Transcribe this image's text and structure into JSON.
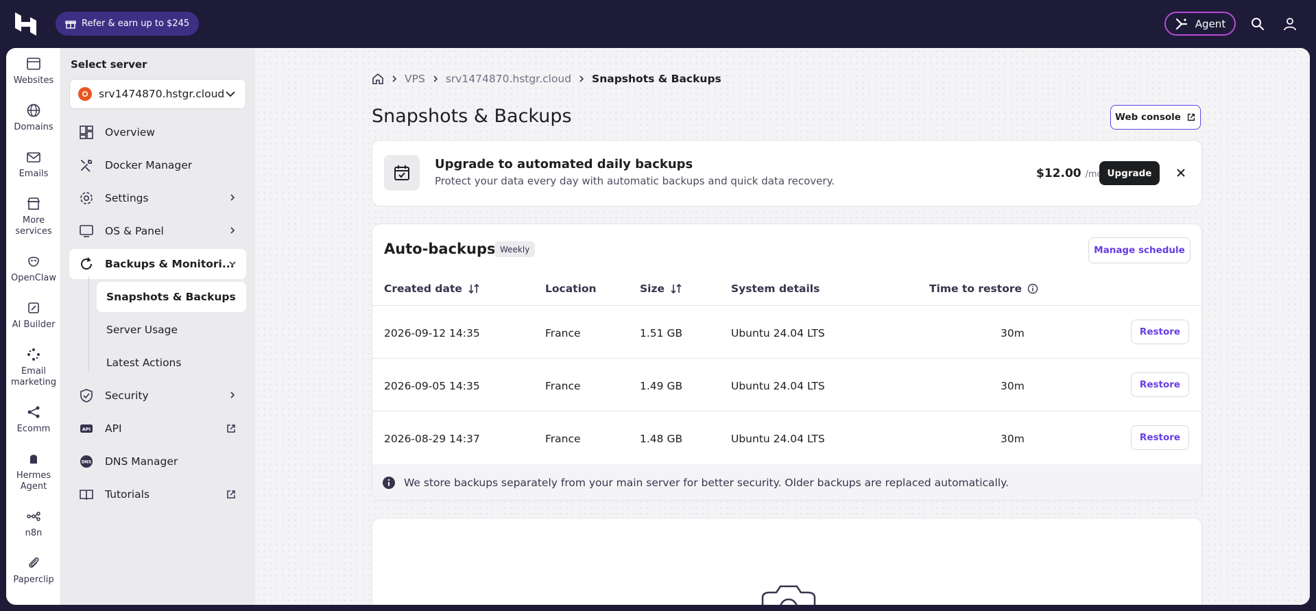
{
  "topbar": {
    "refer_label": "Refer & earn up to $245",
    "agent_label": "Agent"
  },
  "rail": {
    "items": [
      {
        "label": "Websites",
        "icon": "browser-icon"
      },
      {
        "label": "Domains",
        "icon": "globe-icon"
      },
      {
        "label": "Emails",
        "icon": "mail-icon"
      },
      {
        "label": "More services",
        "icon": "store-icon"
      },
      {
        "label": "OpenClaw",
        "icon": "claw-icon"
      },
      {
        "label": "AI Builder",
        "icon": "ai-builder-icon"
      },
      {
        "label": "Email marketing",
        "icon": "sparkle-icon"
      },
      {
        "label": "Ecomm",
        "icon": "share-nodes-icon"
      },
      {
        "label": "Hermes Agent",
        "icon": "hermes-icon"
      },
      {
        "label": "n8n",
        "icon": "n8n-icon"
      },
      {
        "label": "Paperclip",
        "icon": "paperclip-icon"
      }
    ]
  },
  "subnav": {
    "title": "Select server",
    "server": "srv1474870.hstgr.cloud",
    "items": [
      {
        "label": "Overview"
      },
      {
        "label": "Docker Manager"
      },
      {
        "label": "Settings"
      },
      {
        "label": "OS & Panel"
      },
      {
        "label": "Backups & Monitori..."
      },
      {
        "label": "Security"
      },
      {
        "label": "API"
      },
      {
        "label": "DNS Manager"
      },
      {
        "label": "Tutorials"
      }
    ],
    "sub_items": [
      {
        "label": "Snapshots & Backups"
      },
      {
        "label": "Server Usage"
      },
      {
        "label": "Latest Actions"
      }
    ]
  },
  "breadcrumb": {
    "items": [
      "VPS",
      "srv1474870.hstgr.cloud",
      "Snapshots & Backups"
    ]
  },
  "page": {
    "title": "Snapshots & Backups",
    "web_console_label": "Web console"
  },
  "upgrade": {
    "title": "Upgrade to automated daily backups",
    "description": "Protect your data every day with automatic backups and quick data recovery.",
    "price": "$12.00",
    "period": "/mo",
    "button_label": "Upgrade"
  },
  "autobackups": {
    "title": "Auto-backups",
    "frequency_badge": "Weekly",
    "manage_label": "Manage schedule",
    "columns": [
      "Created date",
      "Location",
      "Size",
      "System details",
      "Time to restore"
    ],
    "rows": [
      {
        "date": "2026-09-12 14:35",
        "location": "France",
        "size": "1.51 GB",
        "system": "Ubuntu 24.04 LTS",
        "time": "30m",
        "action": "Restore"
      },
      {
        "date": "2026-09-05 14:35",
        "location": "France",
        "size": "1.49 GB",
        "system": "Ubuntu 24.04 LTS",
        "time": "30m",
        "action": "Restore"
      },
      {
        "date": "2026-08-29 14:37",
        "location": "France",
        "size": "1.48 GB",
        "system": "Ubuntu 24.04 LTS",
        "time": "30m",
        "action": "Restore"
      }
    ],
    "note": "We store backups separately from your main server for better security. Older backups are replaced automatically."
  },
  "colors": {
    "topbar_bg": "#1d1b38",
    "accent": "#673de6",
    "refer_bg": "#3d2f84",
    "agent_border": "#b84bd6",
    "ubuntu": "#e95420"
  }
}
